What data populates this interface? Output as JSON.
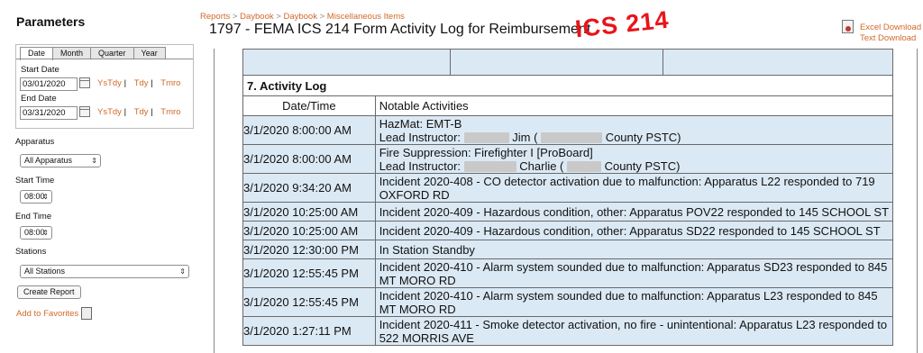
{
  "sidebar": {
    "title": "Parameters",
    "tabs": [
      "Date",
      "Month",
      "Quarter",
      "Year"
    ],
    "start_date_label": "Start Date",
    "start_date_value": "03/01/2020",
    "end_date_label": "End Date",
    "end_date_value": "03/31/2020",
    "quick_links": [
      "YsTdy",
      "Tdy",
      "Tmro"
    ],
    "quick_sep": "|",
    "apparatus_label": "Apparatus",
    "apparatus_value": "All Apparatus",
    "start_time_label": "Start Time",
    "start_time_value": "08:00",
    "end_time_label": "End Time",
    "end_time_value": "08:00",
    "stations_label": "Stations",
    "stations_value": "All Stations",
    "create_button": "Create Report",
    "favorites_link": "Add to Favorites"
  },
  "header": {
    "breadcrumb": [
      "Reports",
      "Daybook",
      "Daybook",
      "Miscellaneous Items"
    ],
    "breadcrumb_sep": ">",
    "title": "1797 - FEMA ICS 214 Form Activity Log for Reimbursement",
    "stamp": "ICS 214",
    "excel_link": "Excel Download",
    "text_link": "Text Download"
  },
  "activity_log": {
    "section_title": "7. Activity Log",
    "col_datetime": "Date/Time",
    "col_activities": "Notable Activities",
    "rows": [
      {
        "dt": "3/1/2020 8:00:00 AM",
        "line1": "HazMat:  EMT-B",
        "line2_prefix": "Lead Instructor:",
        "name": "Jim (",
        "suffix": "County PSTC)"
      },
      {
        "dt": "3/1/2020 8:00:00 AM",
        "line1": "Fire Suppression:  Firefighter I [ProBoard]",
        "line2_prefix": "Lead Instructor:",
        "name": "Charlie (",
        "suffix": "County PSTC)"
      },
      {
        "dt": "3/1/2020 9:34:20 AM",
        "text": "Incident 2020-408 - CO detector activation due to malfunction: Apparatus L22 responded to 719 OXFORD RD"
      },
      {
        "dt": "3/1/2020 10:25:00 AM",
        "text": "Incident 2020-409 - Hazardous condition, other: Apparatus POV22 responded to 145 SCHOOL ST"
      },
      {
        "dt": "3/1/2020 10:25:00 AM",
        "text": "Incident 2020-409 - Hazardous condition, other: Apparatus SD22 responded to 145 SCHOOL ST"
      },
      {
        "dt": "3/1/2020 12:30:00 PM",
        "text": "In Station Standby"
      },
      {
        "dt": "3/1/2020 12:55:45 PM",
        "text": "Incident 2020-410 - Alarm system sounded due to malfunction: Apparatus SD23 responded to 845 MT MORO RD"
      },
      {
        "dt": "3/1/2020 12:55:45 PM",
        "text": "Incident 2020-410 - Alarm system sounded due to malfunction: Apparatus L23 responded to 845 MT MORO RD"
      },
      {
        "dt": "3/1/2020 1:27:11 PM",
        "text": "Incident 2020-411 - Smoke detector activation, no fire - unintentional: Apparatus L23 responded to 522 MORRIS AVE"
      }
    ]
  }
}
